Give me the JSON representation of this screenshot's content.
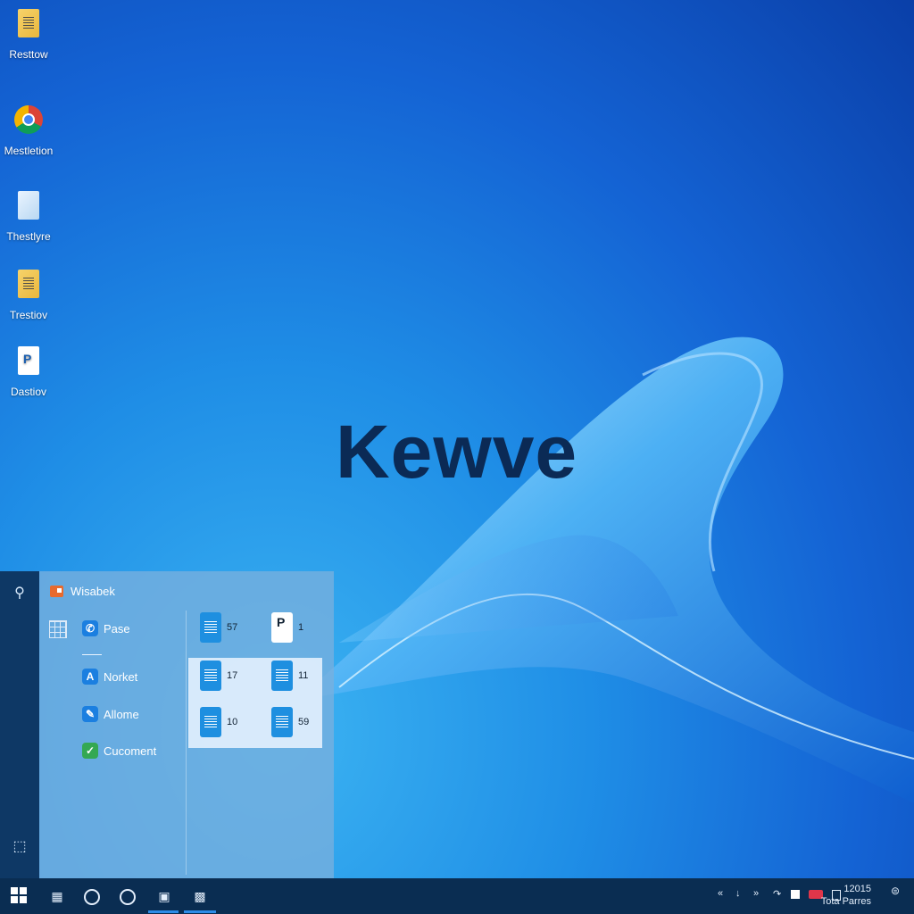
{
  "desktop": {
    "wallpaper_text": "Kewve",
    "icons": [
      {
        "label": "Resttow",
        "icon": "document-icon"
      },
      {
        "label": "Mestletion",
        "icon": "chrome-icon"
      },
      {
        "label": "Thestlyre",
        "icon": "folder-icon"
      },
      {
        "label": "Trestiov",
        "icon": "document-icon"
      },
      {
        "label": "Dastiov",
        "icon": "pdf-icon"
      }
    ]
  },
  "start_menu": {
    "header_label": "Wisabek",
    "apps": [
      {
        "label": "Pase",
        "icon": "phone-icon",
        "color": "#1b7fe0"
      },
      {
        "label": "Norket",
        "icon": "a-icon",
        "color": "#1b7fe0"
      },
      {
        "label": "Allome",
        "icon": "pen-icon",
        "color": "#1b7fe0"
      },
      {
        "label": "Cucoment",
        "icon": "chat-icon",
        "color": "#34a853"
      }
    ],
    "files": [
      {
        "label": "57"
      },
      {
        "label": "1"
      },
      {
        "label": "17"
      },
      {
        "label": "11"
      },
      {
        "label": "10"
      },
      {
        "label": "59"
      }
    ]
  },
  "taskbar": {
    "clock": {
      "time": "12015",
      "date": "Tota Parres"
    }
  }
}
